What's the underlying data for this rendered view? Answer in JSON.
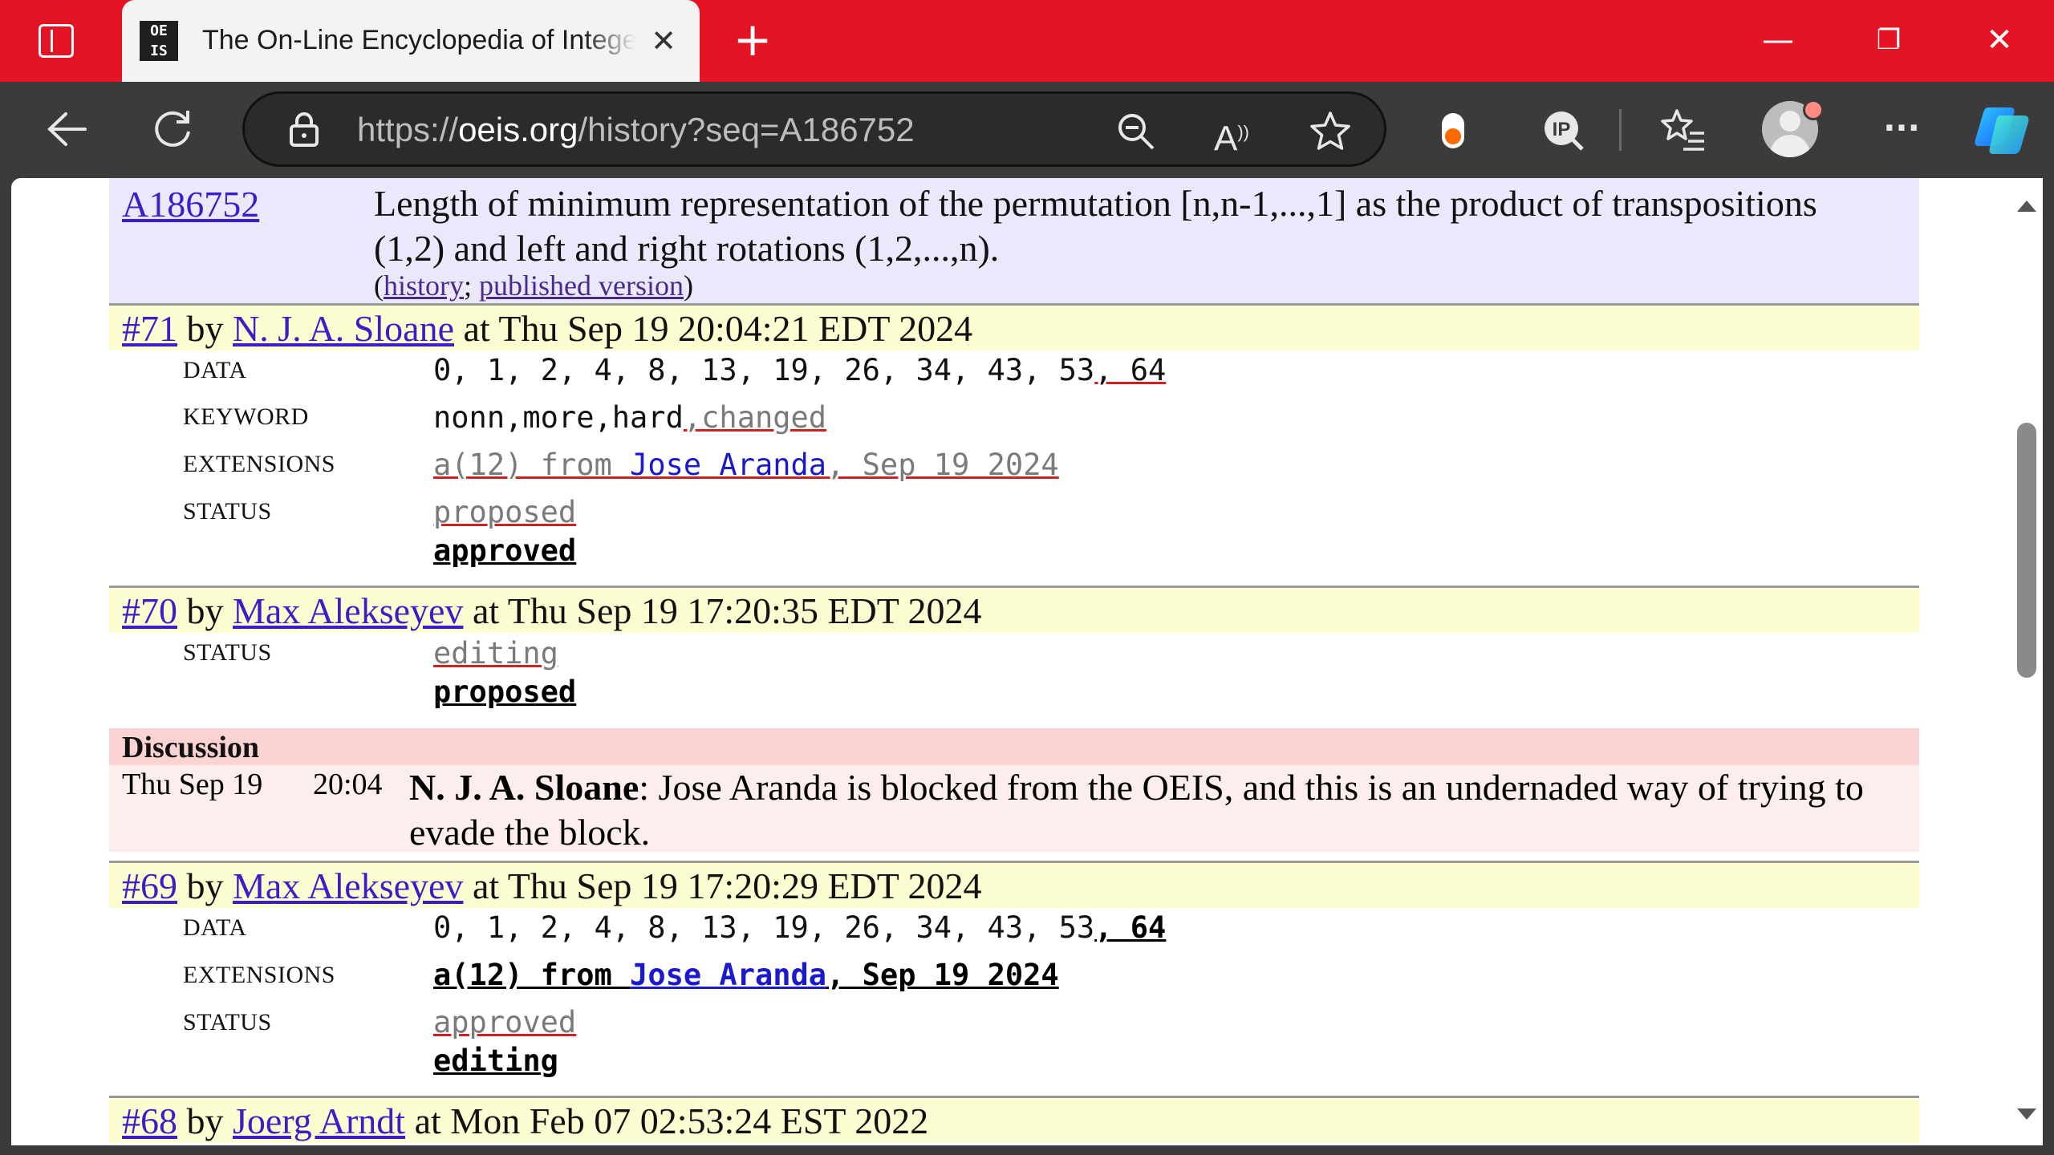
{
  "browser": {
    "tab_title": "The On-Line Encyclopedia of Integer Sequences",
    "favicon_text_top": "OE",
    "favicon_text_bottom": "IS",
    "tab_close": "✕",
    "new_tab": "+",
    "url_prefix": "https://",
    "url_host": "oeis.org",
    "url_path": "/history?seq=A186752",
    "window_controls": {
      "minimize": "—",
      "restore": "❐",
      "close": "✕"
    },
    "icons": [
      "back-icon",
      "refresh-icon",
      "lock-icon",
      "zoom-out-icon",
      "read-aloud-icon",
      "favorite-icon",
      "extension-icon",
      "ip-icon",
      "favorites-list-icon",
      "profile-icon",
      "more-icon",
      "copilot-icon"
    ],
    "more_label": "···",
    "accent_color": "#e51425"
  },
  "sequence": {
    "id": "A186752",
    "name_line1": "Length of minimum representation of the permutation [n,n-1,...,1] as the product of transpositions",
    "name_line2": "(1,2) and left and right rotations (1,2,...,n).",
    "link_open": "(",
    "history_link": "history",
    "link_sep": "; ",
    "published_link": "published version",
    "link_close": ")"
  },
  "revisions": [
    {
      "num": "#71",
      "by": " by ",
      "author": "N. J. A. Sloane",
      "at": " at Thu Sep 19 20:04:21 EDT 2024",
      "data_label": "DATA",
      "data_base": "0, 1, 2, 4, 8, 13, 19, 26, 34, 43, 53",
      "data_removed": ", 64",
      "keyword_label": "KEYWORD",
      "keyword_base": "nonn,more,hard",
      "keyword_removed": ",changed",
      "ext_label": "EXTENSIONS",
      "ext_removed_a": "a(12) from ",
      "ext_removed_name": "Jose Aranda",
      "ext_removed_b": ", Sep 19 2024",
      "status_label": "STATUS",
      "status_old": "proposed",
      "status_new": "approved"
    },
    {
      "num": "#70",
      "by": " by ",
      "author": "Max Alekseyev",
      "at": " at Thu Sep 19 17:20:35 EDT 2024",
      "status_label": "STATUS",
      "status_old": "editing",
      "status_new": "proposed"
    },
    {
      "num": "#69",
      "by": " by ",
      "author": "Max Alekseyev",
      "at": " at Thu Sep 19 17:20:29 EDT 2024",
      "data_label": "DATA",
      "data_base": "0, 1, 2, 4, 8, 13, 19, 26, 34, 43, 53",
      "data_added": ", 64",
      "ext_label": "EXTENSIONS",
      "ext_added_a": "a(12) from ",
      "ext_added_name": "Jose Aranda",
      "ext_added_b": ", Sep 19 2024",
      "status_label": "STATUS",
      "status_old": "approved",
      "status_new": "editing"
    },
    {
      "num": "#68",
      "by": " by ",
      "author": "Joerg Arndt",
      "at": " at Mon Feb 07 02:53:24 EST 2022"
    }
  ],
  "discussion": {
    "heading": "Discussion",
    "date": "Thu Sep 19",
    "time": "20:04",
    "author": "N. J. A. Sloane",
    "text": ": Jose Aranda is blocked from the OEIS, and this is an undernaded way of trying to evade the block."
  }
}
